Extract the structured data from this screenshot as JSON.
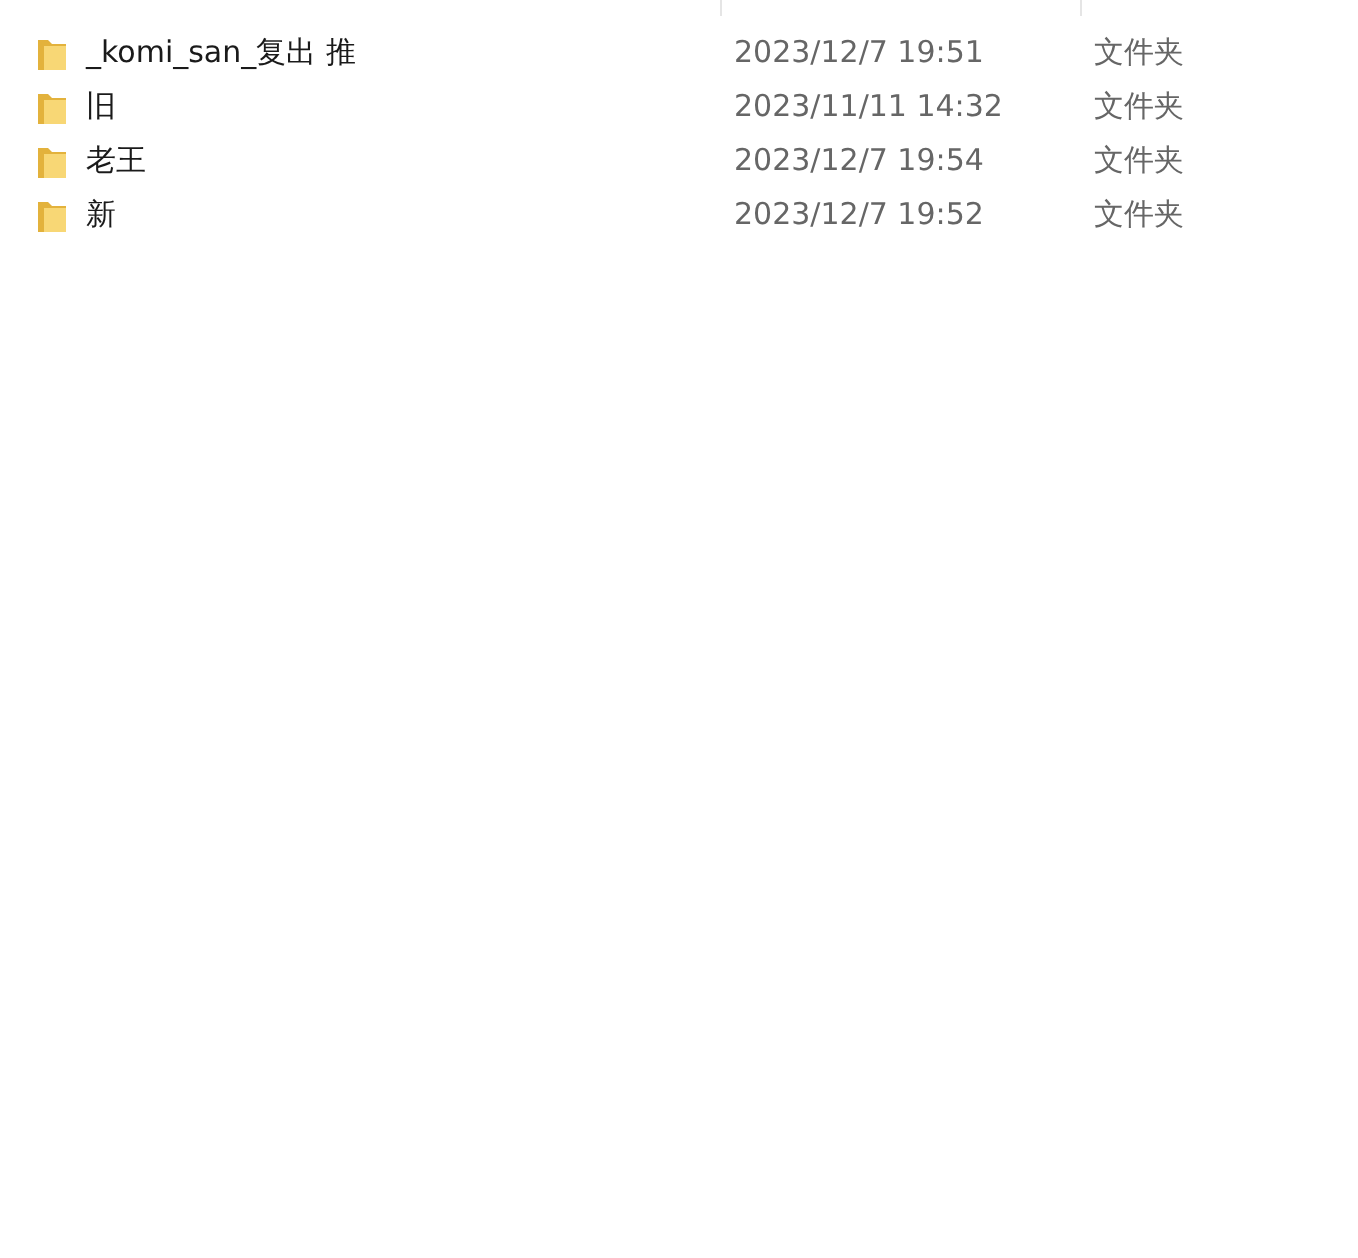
{
  "files": [
    {
      "name": "_komi_san_复出 推",
      "modified": "2023/12/7 19:51",
      "type": "文件夹"
    },
    {
      "name": "旧",
      "modified": "2023/11/11 14:32",
      "type": "文件夹"
    },
    {
      "name": "老王",
      "modified": "2023/12/7 19:54",
      "type": "文件夹"
    },
    {
      "name": "新",
      "modified": "2023/12/7 19:52",
      "type": "文件夹"
    }
  ]
}
